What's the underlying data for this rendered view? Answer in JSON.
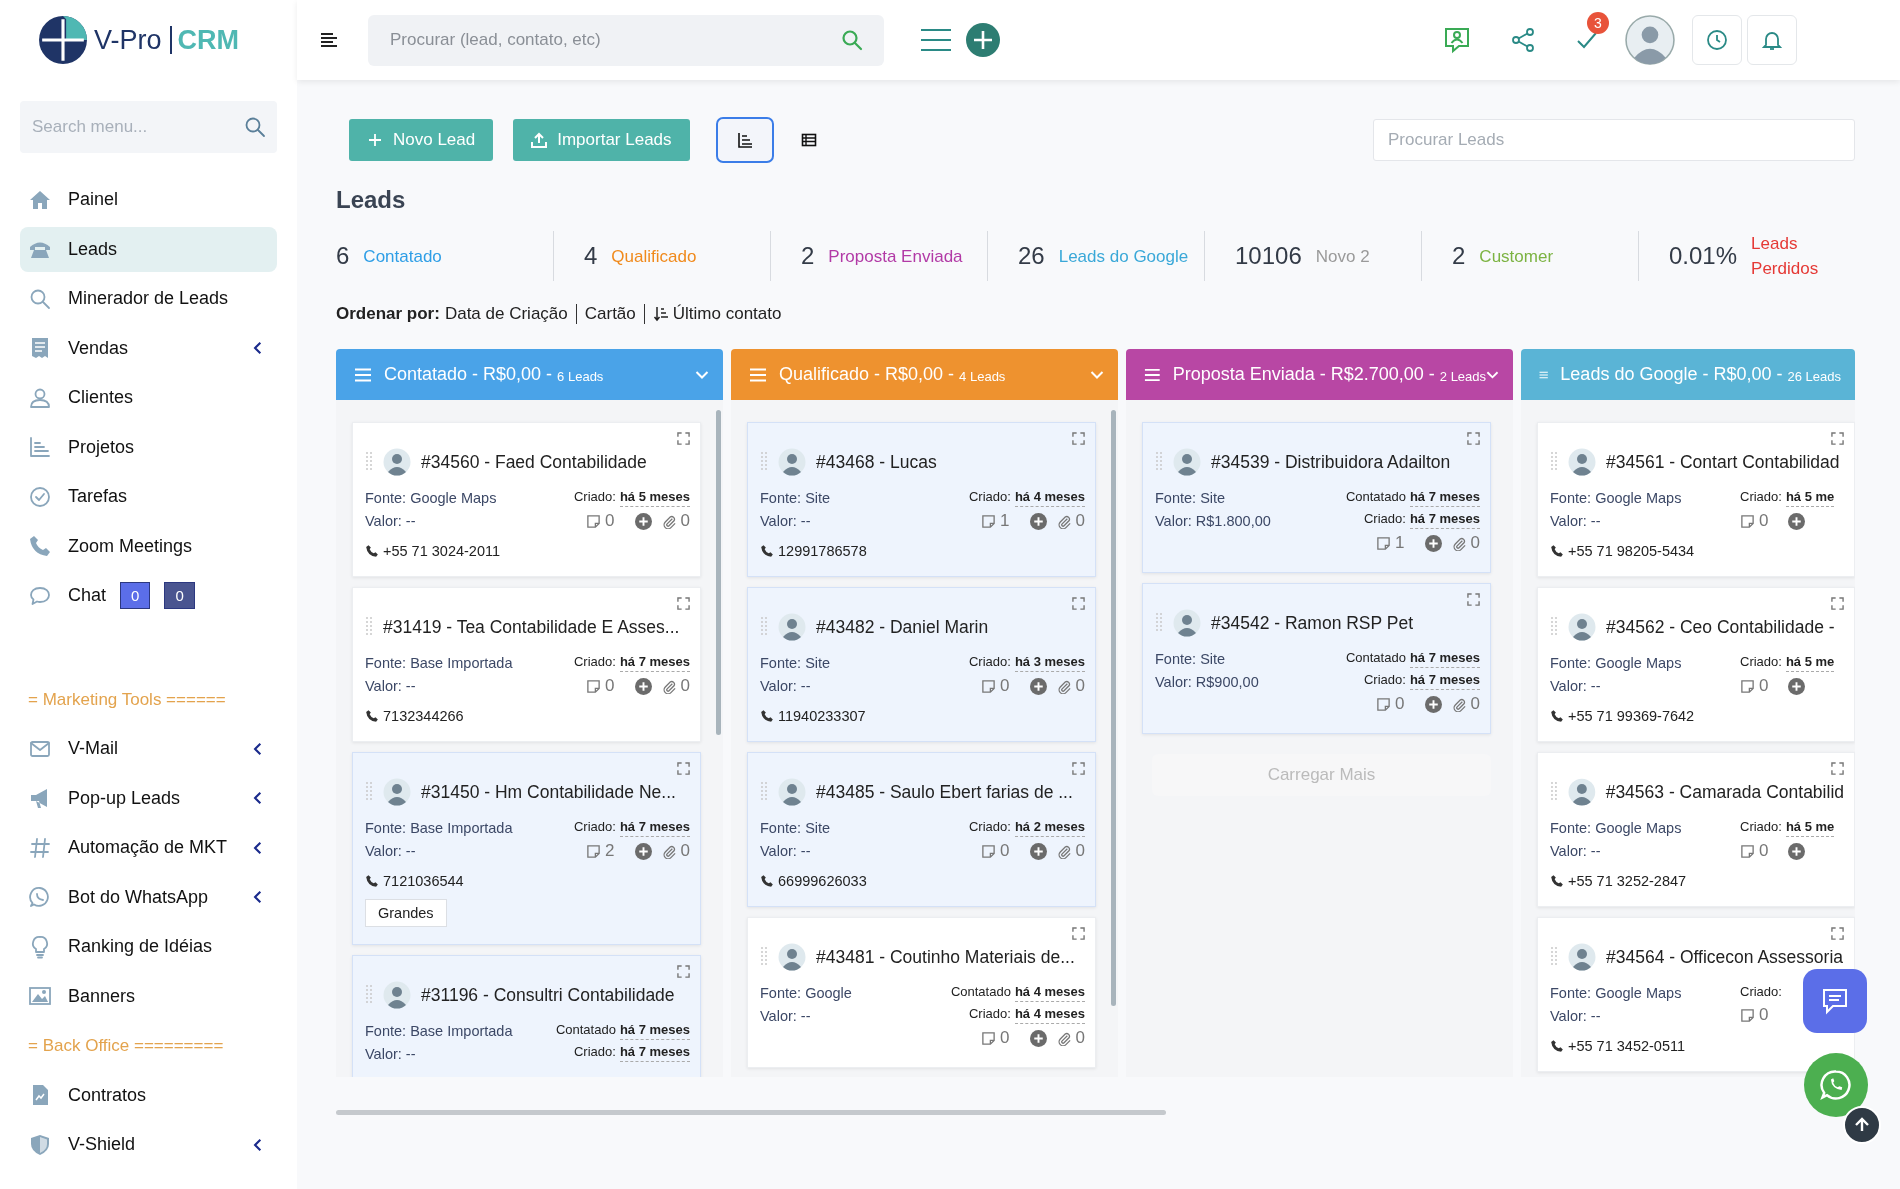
{
  "logo": {
    "name": "V-Pro",
    "product": "CRM"
  },
  "sidebar": {
    "search": {
      "placeholder": "Search menu..."
    },
    "items": [
      {
        "kind": "item",
        "label": "Painel",
        "selected": false,
        "expandable": false
      },
      {
        "kind": "item",
        "label": "Leads",
        "selected": true,
        "expandable": false
      },
      {
        "kind": "item",
        "label": "Minerador de Leads",
        "selected": false,
        "expandable": false
      },
      {
        "kind": "item",
        "label": "Vendas",
        "selected": false,
        "expandable": true
      },
      {
        "kind": "item",
        "label": "Clientes",
        "selected": false,
        "expandable": false
      },
      {
        "kind": "item",
        "label": "Projetos",
        "selected": false,
        "expandable": false
      },
      {
        "kind": "item",
        "label": "Tarefas",
        "selected": false,
        "expandable": false
      },
      {
        "kind": "item",
        "label": "Zoom Meetings",
        "selected": false,
        "expandable": false
      },
      {
        "kind": "item",
        "label": "Chat",
        "selected": false,
        "expandable": false,
        "badges": [
          {
            "text": "0",
            "color": "#5b6ee8"
          },
          {
            "text": "0",
            "color": "#4a5590"
          }
        ]
      },
      {
        "kind": "section",
        "label": "= Marketing Tools ======"
      },
      {
        "kind": "item",
        "label": "V-Mail",
        "selected": false,
        "expandable": true
      },
      {
        "kind": "item",
        "label": "Pop-up Leads",
        "selected": false,
        "expandable": true
      },
      {
        "kind": "item",
        "label": "Automação de MKT",
        "selected": false,
        "expandable": true
      },
      {
        "kind": "item",
        "label": "Bot do WhatsApp",
        "selected": false,
        "expandable": true
      },
      {
        "kind": "item",
        "label": "Ranking de Idéias",
        "selected": false,
        "expandable": false
      },
      {
        "kind": "item",
        "label": "Banners",
        "selected": false,
        "expandable": false
      },
      {
        "kind": "section",
        "label": "= Back Office ========="
      },
      {
        "kind": "item",
        "label": "Contratos",
        "selected": false,
        "expandable": false
      },
      {
        "kind": "item",
        "label": "V-Shield",
        "selected": false,
        "expandable": true
      }
    ]
  },
  "topbar": {
    "search": {
      "placeholder": "Procurar (lead, contato, etc)"
    },
    "task_badge": "3"
  },
  "toolbar": {
    "buttons": [
      {
        "kind": "add",
        "label": "Novo Lead"
      },
      {
        "kind": "upload",
        "label": "Importar Leads"
      }
    ],
    "views": [
      {
        "kind": "kanban",
        "selected": true
      },
      {
        "kind": "table",
        "selected": false
      }
    ],
    "search": {
      "placeholder": "Procurar Leads"
    }
  },
  "title": "Leads",
  "stats": [
    {
      "count": "6",
      "label": "Contatado",
      "color": "#2e9ee6"
    },
    {
      "count": "4",
      "label": "Qualificado",
      "color": "#f08a1c"
    },
    {
      "count": "2",
      "label": "Proposta Enviada",
      "color": "#b23aa6"
    },
    {
      "count": "26",
      "label": "Leads do Google",
      "color": "#3aa8d8"
    },
    {
      "count": "10106",
      "label": "Novo 2",
      "color": "#9a9a9a"
    },
    {
      "count": "2",
      "label": "Customer",
      "color": "#7cb342"
    },
    {
      "count": "0.01%",
      "label": "Leads Perdidos",
      "color": "#e53935"
    }
  ],
  "sort": {
    "label": "Ordenar por:",
    "options": [
      {
        "text": "Data de Criação",
        "icon": false
      },
      {
        "text": "Cartão",
        "icon": false
      },
      {
        "text": "Último contato",
        "icon": true
      }
    ]
  },
  "board": {
    "columns": [
      {
        "title": "Contatado - R$0,00 -",
        "count": "6 Leads",
        "color": "#4aa3e8",
        "dropdown": true,
        "scrollbar": true,
        "cards": [
          {
            "title": "#34560 - Faed Contabilidade",
            "avatar": true,
            "highlighted": false,
            "source": "Fonte: Google Maps",
            "value": "Valor: --",
            "dates": [
              {
                "label": "Criado:",
                "value": "há 5 meses"
              }
            ],
            "notes": "0",
            "add": true,
            "attachments": "0",
            "phone": "+55 71 3024-2011"
          },
          {
            "title": "#31419 - Tea Contabilidade E Asses...",
            "avatar": false,
            "highlighted": false,
            "source": "Fonte: Base Importada",
            "value": "Valor: --",
            "dates": [
              {
                "label": "Criado:",
                "value": "há 7 meses"
              }
            ],
            "notes": "0",
            "add": true,
            "attachments": "0",
            "phone": "7132344266"
          },
          {
            "title": "#31450 - Hm Contabilidade Ne...",
            "avatar": true,
            "highlighted": true,
            "source": "Fonte: Base Importada",
            "value": "Valor: --",
            "dates": [
              {
                "label": "Criado:",
                "value": "há 7 meses"
              }
            ],
            "notes": "2",
            "add": true,
            "attachments": "0",
            "phone": "7121036544",
            "tag": "Grandes"
          },
          {
            "title": "#31196 - Consultri Contabilidade",
            "avatar": true,
            "highlighted": true,
            "source": "Fonte: Base Importada",
            "value": "Valor: --",
            "dates": [
              {
                "label": "Contatado",
                "value": "há 7 meses"
              },
              {
                "label": "Criado:",
                "value": "há 7 meses"
              }
            ]
          }
        ]
      },
      {
        "title": "Qualificado - R$0,00 -",
        "count": "4 Leads",
        "color": "#ee922f",
        "dropdown": true,
        "scrollbar": true,
        "cards": [
          {
            "title": "#43468 - Lucas",
            "avatar": true,
            "highlighted": true,
            "source": "Fonte: Site",
            "value": "Valor: --",
            "dates": [
              {
                "label": "Criado:",
                "value": "há 4 meses"
              }
            ],
            "notes": "1",
            "add": true,
            "attachments": "0",
            "phone": "12991786578"
          },
          {
            "title": "#43482 - Daniel Marin",
            "avatar": true,
            "highlighted": true,
            "source": "Fonte: Site",
            "value": "Valor: --",
            "dates": [
              {
                "label": "Criado:",
                "value": "há 3 meses"
              }
            ],
            "notes": "0",
            "add": true,
            "attachments": "0",
            "phone": "11940233307"
          },
          {
            "title": "#43485 - Saulo Ebert farias de ...",
            "avatar": true,
            "highlighted": true,
            "source": "Fonte: Site",
            "value": "Valor: --",
            "dates": [
              {
                "label": "Criado:",
                "value": "há 2 meses"
              }
            ],
            "notes": "0",
            "add": true,
            "attachments": "0",
            "phone": "66999626033"
          },
          {
            "title": "#43481 - Coutinho Materiais de...",
            "avatar": true,
            "highlighted": false,
            "source": "Fonte: Google",
            "value": "Valor: --",
            "dates": [
              {
                "label": "Contatado",
                "value": "há 4 meses"
              },
              {
                "label": "Criado:",
                "value": "há 4 meses"
              }
            ],
            "notes": "0",
            "add": true,
            "attachments": "0"
          }
        ]
      },
      {
        "title": "Proposta Enviada - R$2.700,00 -",
        "count": "2 Leads",
        "color": "#b847a4",
        "dropdown": true,
        "scrollbar": false,
        "load_more": "Carregar Mais",
        "cards": [
          {
            "title": "#34539 - Distribuidora Adailton",
            "avatar": true,
            "highlighted": true,
            "source": "Fonte: Site",
            "value": "Valor: R$1.800,00",
            "dates": [
              {
                "label": "Contatado",
                "value": "há 7 meses"
              },
              {
                "label": "Criado:",
                "value": "há 7 meses"
              }
            ],
            "notes": "1",
            "add": true,
            "attachments": "0"
          },
          {
            "title": "#34542 - Ramon RSP Pet",
            "avatar": true,
            "highlighted": true,
            "source": "Fonte: Site",
            "value": "Valor: R$900,00",
            "dates": [
              {
                "label": "Contatado",
                "value": "há 7 meses"
              },
              {
                "label": "Criado:",
                "value": "há 7 meses"
              }
            ],
            "notes": "0",
            "add": true,
            "attachments": "0"
          }
        ]
      },
      {
        "title": "Leads do Google - R$0,00 -",
        "count": "26 Leads",
        "color": "#5ab4d6",
        "dropdown": false,
        "scrollbar": false,
        "cards": [
          {
            "title": "#34561 - Contart Contabilidad",
            "avatar": true,
            "highlighted": false,
            "source": "Fonte: Google Maps",
            "value": "Valor: --",
            "dates": [
              {
                "label": "Criado:",
                "value": "há 5 me"
              }
            ],
            "notes": "0",
            "add": true,
            "phone": "+55 71 98205-5434"
          },
          {
            "title": "#34562 - Ceo Contabilidade -",
            "avatar": true,
            "highlighted": false,
            "source": "Fonte: Google Maps",
            "value": "Valor: --",
            "dates": [
              {
                "label": "Criado:",
                "value": "há 5 me"
              }
            ],
            "notes": "0",
            "add": true,
            "phone": "+55 71 99369-7642"
          },
          {
            "title": "#34563 - Camarada Contabilid",
            "avatar": true,
            "highlighted": false,
            "source": "Fonte: Google Maps",
            "value": "Valor: --",
            "dates": [
              {
                "label": "Criado:",
                "value": "há 5 me"
              }
            ],
            "notes": "0",
            "add": true,
            "phone": "+55 71 3252-2847"
          },
          {
            "title": "#34564 - Officecon Assessoria",
            "avatar": true,
            "highlighted": false,
            "source": "Fonte: Google Maps",
            "value": "Valor: --",
            "dates": [
              {
                "label": "Criado:"
              }
            ],
            "notes": "0",
            "add": false,
            "phone": "+55 71 3452-0511"
          }
        ]
      }
    ]
  }
}
